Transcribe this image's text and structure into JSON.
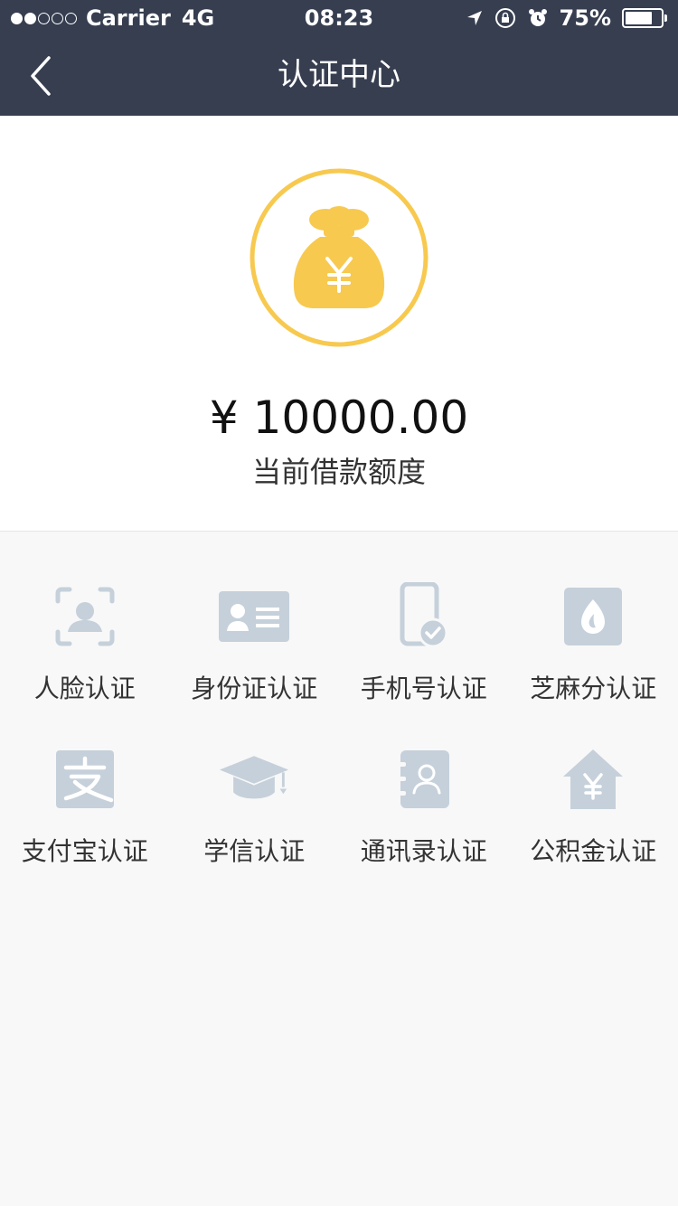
{
  "status_bar": {
    "carrier": "Carrier",
    "network": "4G",
    "time": "08:23",
    "battery_percent": "75%",
    "battery_level": 0.75,
    "signal_strength_of_5": 2
  },
  "nav": {
    "title": "认证中心",
    "back_icon": "chevron-left-icon"
  },
  "quota": {
    "amount": "¥ 10000.00",
    "label": "当前借款额度",
    "icon": "money-bag-icon",
    "icon_color": "#f7c94f"
  },
  "colors": {
    "nav_bg": "#363e50",
    "icon_gray": "#c5d0da",
    "page_bg": "#f8f8f8"
  },
  "items": [
    {
      "label": "人脸认证",
      "icon": "face-scan-icon"
    },
    {
      "label": "身份证认证",
      "icon": "id-card-icon"
    },
    {
      "label": "手机号认证",
      "icon": "phone-verified-icon"
    },
    {
      "label": "芝麻分认证",
      "icon": "sesame-credit-icon"
    },
    {
      "label": "支付宝认证",
      "icon": "alipay-icon"
    },
    {
      "label": "学信认证",
      "icon": "graduation-cap-icon"
    },
    {
      "label": "通讯录认证",
      "icon": "contacts-book-icon"
    },
    {
      "label": "公积金认证",
      "icon": "housing-fund-icon"
    }
  ]
}
